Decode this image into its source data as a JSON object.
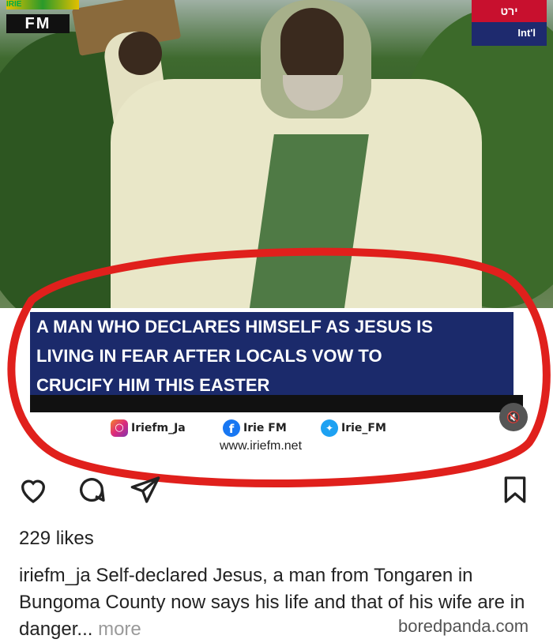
{
  "photo": {
    "logo_left": {
      "top_text": "IRIE",
      "fm_text": "FM"
    },
    "logo_right": {
      "top_text": "ירט",
      "intl_text": "Int'l"
    }
  },
  "headline": {
    "lines": [
      "A MAN WHO DECLARES HIMSELF AS JESUS IS",
      "LIVING IN FEAR AFTER LOCALS VOW TO",
      "CRUCIFY HIM THIS EASTER"
    ]
  },
  "socials": {
    "instagram": "Iriefm_Ja",
    "facebook": "Irie FM",
    "twitter": "Irie_FM",
    "website": "www.iriefm.net"
  },
  "post": {
    "likes": "229 likes",
    "username": "iriefm_ja",
    "caption": "Self-declared Jesus, a man from Tongaren in Bungoma County now says his life and that of his wife are in danger...",
    "more": "more"
  },
  "watermark": "boredpanda.com",
  "colors": {
    "headline_bg": "#1b2a6b",
    "ring": "#e0201c"
  },
  "icons": [
    "heart-icon",
    "comment-icon",
    "share-icon",
    "bookmark-icon",
    "mute-icon"
  ]
}
